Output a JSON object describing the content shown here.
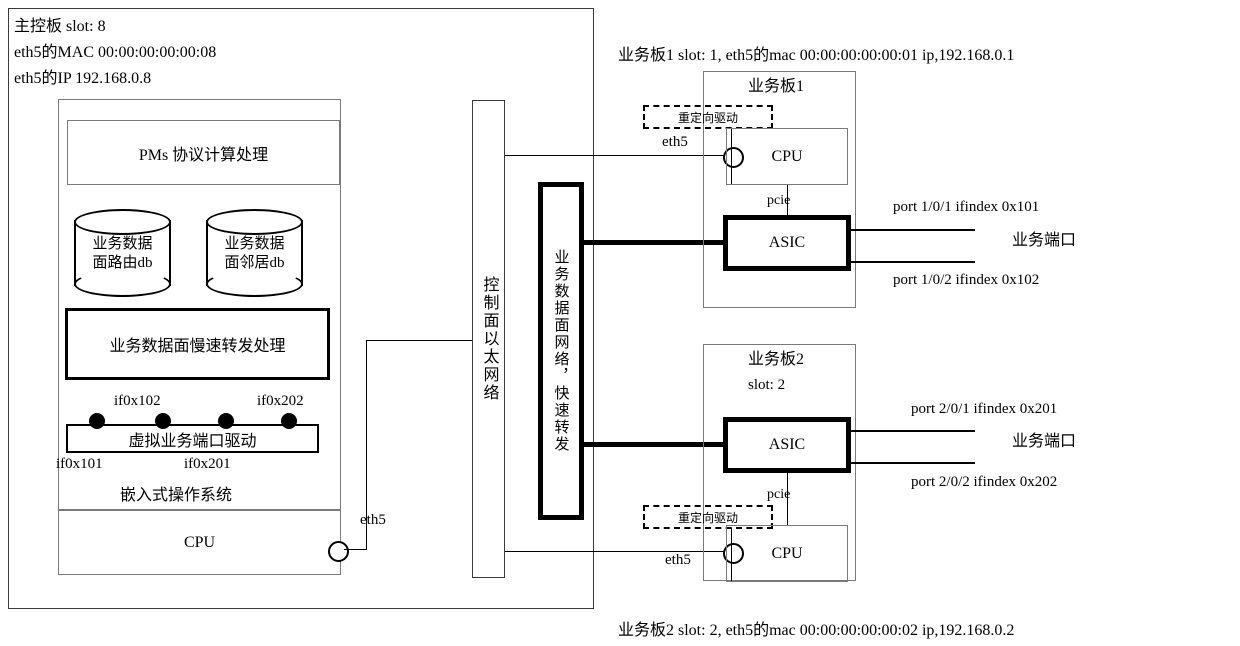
{
  "main_board": {
    "header_lines": [
      "主控板 slot: 8",
      "eth5的MAC 00:00:00:00:00:08",
      "eth5的IP   192.168.0.8"
    ],
    "pms_box": "PMs 协议计算处理",
    "db_route": "业务数据\n面路由db",
    "db_route_line1": "业务数据",
    "db_route_line2": "面路由db",
    "db_neighbor_line1": "业务数据",
    "db_neighbor_line2": "面邻居db",
    "slow_forward": "业务数据面慢速转发处理",
    "virtual_port_driver": "虚拟业务端口驱动",
    "os_label": "嵌入式操作系统",
    "cpu_label": "CPU",
    "eth5_label": "eth5",
    "if_labels": {
      "if0x102": "if0x102",
      "if0x202": "if0x202",
      "if0x101": "if0x101",
      "if0x201": "if0x201"
    }
  },
  "control_plane": {
    "label": "控制面以太网络"
  },
  "data_plane": {
    "label": "业务数据面网络，快速转发"
  },
  "board1": {
    "caption": "业务板1 slot: 1, eth5的mac 00:00:00:00:00:01 ip,192.168.0.1",
    "title": "业务板1",
    "redirect_driver": "重定向驱动",
    "eth5_label": "eth5",
    "cpu_label": "CPU",
    "pcie_label": "pcie",
    "asic_label": "ASIC",
    "port_top": "port 1/0/1 ifindex 0x101",
    "port_bottom": "port 1/0/2 ifindex 0x102",
    "service_port": "业务端口"
  },
  "board2": {
    "caption": "业务板2 slot: 2, eth5的mac 00:00:00:00:00:02 ip,192.168.0.2",
    "title": "业务板2",
    "slot": "slot: 2",
    "redirect_driver": "重定向驱动",
    "eth5_label": "eth5",
    "cpu_label": "CPU",
    "pcie_label": "pcie",
    "asic_label": "ASIC",
    "port_top": "port 2/0/1 ifindex 0x201",
    "port_bottom": "port 2/0/2 ifindex 0x202",
    "service_port": "业务端口"
  },
  "colors": {
    "line": "#000000",
    "thin_border": "#7a7a7a",
    "background": "#ffffff"
  }
}
